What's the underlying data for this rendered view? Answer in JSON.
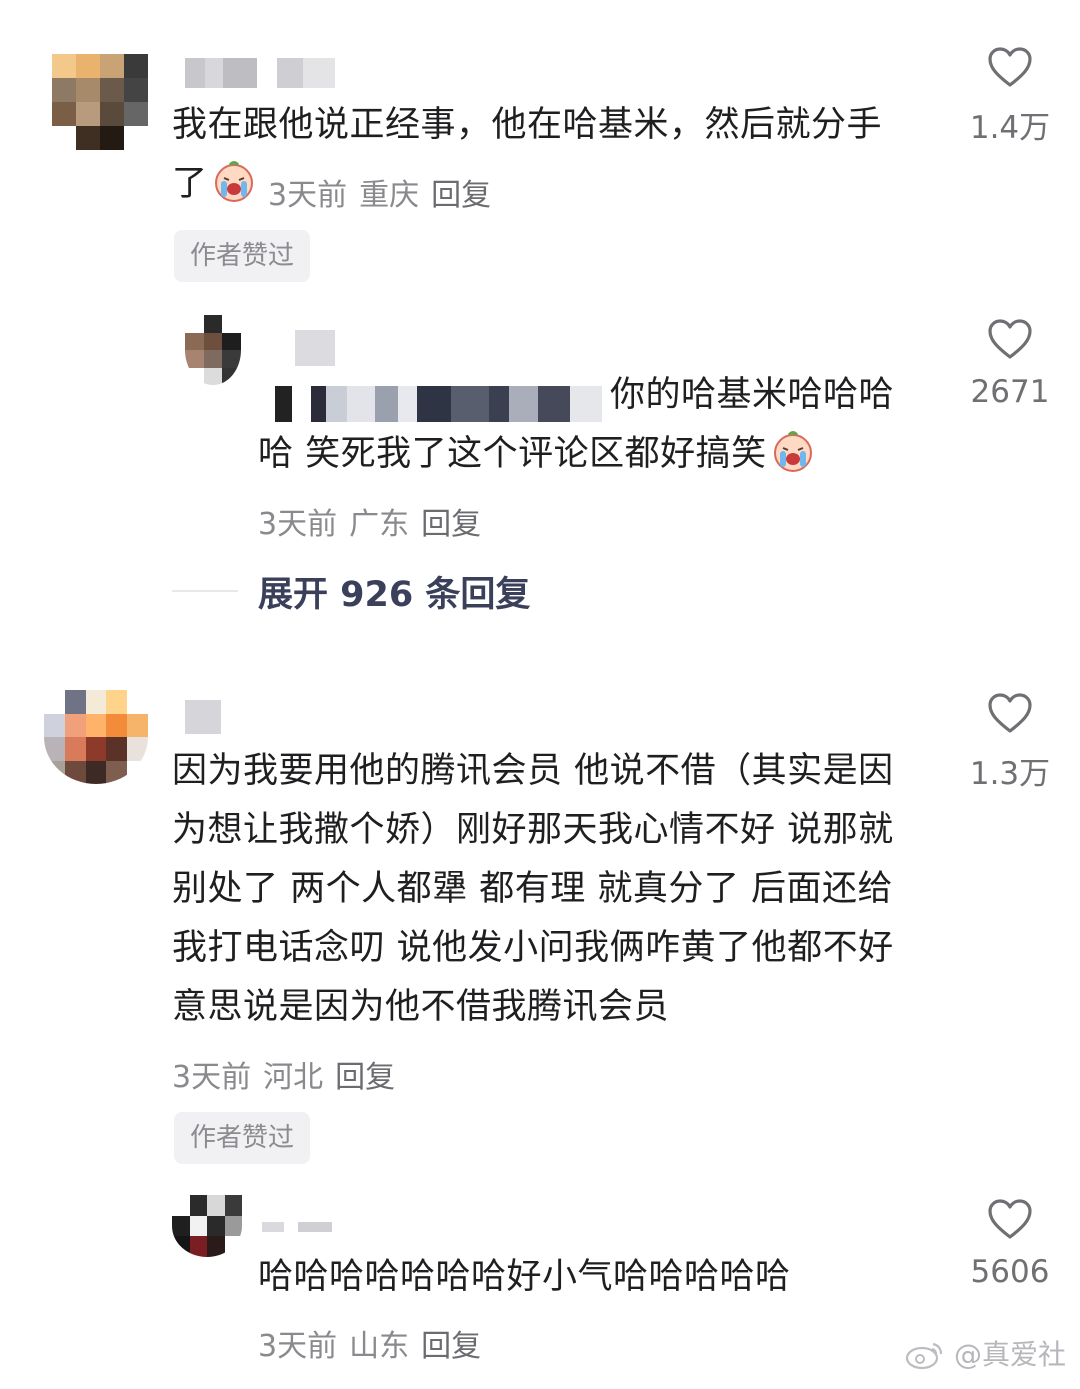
{
  "comments": [
    {
      "text_line1": "我在跟他说正经事，他在哈基米，然后就分手",
      "text_line2": "了",
      "time": "3天前",
      "location": "重庆",
      "reply": "回复",
      "badge": "作者赞过",
      "likes": "1.4万"
    },
    {
      "text_line1": "你的哈基米哈哈哈",
      "text_line2": "哈 笑死我了这个评论区都好搞笑",
      "time": "3天前",
      "location": "广东",
      "reply": "回复",
      "likes": "2671",
      "expand": "展开 926 条回复"
    },
    {
      "lines": [
        "因为我要用他的腾讯会员 他说不借（其实是因",
        "为想让我撒个娇）刚好那天我心情不好 说那就",
        "别处了 两个人都犟 都有理 就真分了 后面还给",
        "我打电话念叨 说他发小问我俩咋黄了他都不好",
        "意思说是因为他不借我腾讯会员"
      ],
      "time": "3天前",
      "location": "河北",
      "reply": "回复",
      "badge": "作者赞过",
      "likes": "1.3万"
    },
    {
      "text": "哈哈哈哈哈哈哈好小气哈哈哈哈哈",
      "time": "3天前",
      "location": "山东",
      "reply": "回复",
      "likes": "5606"
    }
  ],
  "watermark": "@真爱社",
  "icons": {
    "like": "heart-icon",
    "emoji": "crying-laughing-emoji-icon",
    "weibo": "weibo-logo-icon"
  }
}
